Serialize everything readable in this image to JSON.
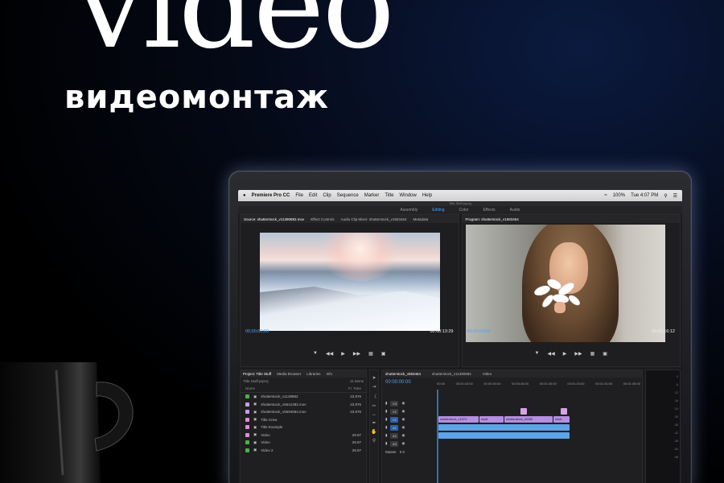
{
  "hero": {
    "title": "video",
    "subtitle": "видеомонтаж"
  },
  "menubar": {
    "app_name": "Premiere Pro CC",
    "menus": [
      "File",
      "Edit",
      "Clip",
      "Sequence",
      "Marker",
      "Title",
      "Window",
      "Help"
    ],
    "battery": "100%",
    "clock": "Tue 4:07 PM"
  },
  "workspaces": [
    "Assembly",
    "Editing",
    "Color",
    "Effects",
    "Audio"
  ],
  "active_workspace": "Editing",
  "source_monitor": {
    "tabs": [
      "Source: shutterstock_v11390882.mov",
      "Effect Controls",
      "Audio Clip Mixer: shutterstock_v1583464",
      "Metadata"
    ],
    "timecode": "00;00;00;00",
    "duration": "00:00:13:29",
    "fit": "1/2"
  },
  "program_monitor": {
    "tab": "Program: shutterstock_v1583464",
    "timecode": "00;00;00;00",
    "duration": "00:01:16:12",
    "fit": "1/4"
  },
  "project_panel": {
    "tabs": [
      "Project: Title Stuff",
      "Media Browser",
      "Libraries",
      "Info"
    ],
    "path": "Title Stuff.prproj",
    "item_count": "11 Items",
    "columns": [
      "Name",
      "Fr. Rate"
    ],
    "items": [
      {
        "name": "shutterstock_v1138882",
        "rate": "23.976",
        "color": "#47b34a"
      },
      {
        "name": "shutterstock_v5641382.mov",
        "rate": "23.976",
        "color": "#c4a0e8"
      },
      {
        "name": "shutterstock_v5594684.mov",
        "rate": "23.976",
        "color": "#c4a0e8"
      },
      {
        "name": "Title Crew",
        "rate": "",
        "color": "#e58ad2"
      },
      {
        "name": "Title Example",
        "rate": "",
        "color": "#e58ad2"
      },
      {
        "name": "Video",
        "rate": "29.97",
        "color": "#e58ad2"
      },
      {
        "name": "Video",
        "rate": "29.97",
        "color": "#47b34a"
      },
      {
        "name": "Video 2",
        "rate": "29.97",
        "color": "#47b34a"
      }
    ]
  },
  "timeline": {
    "tabs": [
      "shutterstock_v583464",
      "shutterstock_v11390882",
      "Video"
    ],
    "timecode": "00:00:00:00",
    "ruler": [
      "00:00",
      "00:00:15:00",
      "00:00:30:00",
      "00:00:45:00",
      "00:01:00:00",
      "00:01:15:00",
      "00:01:30:00",
      "00:01:45:00"
    ],
    "tracks": [
      "V3",
      "V2",
      "V1",
      "A1",
      "A2",
      "A3"
    ],
    "master": "Master",
    "master_value": "0.0",
    "clips_v1": [
      "shutterstock_v1574",
      "shutt",
      "shutterstock_v5285",
      "shutt"
    ]
  },
  "meters": {
    "scale": [
      "0",
      "-6",
      "-12",
      "-18",
      "-24",
      "-30",
      "-36",
      "-42",
      "-48",
      "-54",
      "dB"
    ]
  }
}
